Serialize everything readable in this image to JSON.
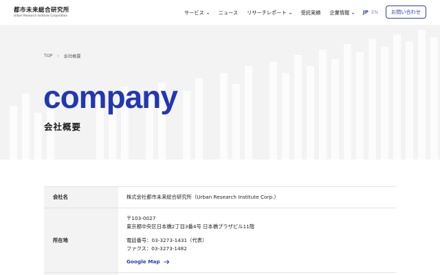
{
  "header": {
    "logo_main": "都市未来総合研究所",
    "logo_sub": "Urban Research Institute Corporation",
    "nav": [
      {
        "label": "サービス",
        "has_dropdown": true
      },
      {
        "label": "ニュース",
        "has_dropdown": false
      },
      {
        "label": "リサーチレポート",
        "has_dropdown": true
      },
      {
        "label": "受託実績",
        "has_dropdown": false
      },
      {
        "label": "企業情報",
        "has_dropdown": true
      }
    ],
    "lang_jp": "JP",
    "lang_en": "EN",
    "contact_label": "お問い合わせ"
  },
  "breadcrumb": {
    "home": "TOP",
    "separator": "›",
    "current": "会社概要"
  },
  "hero": {
    "title": "company",
    "subtitle": "会社概要"
  },
  "table": {
    "rows": [
      {
        "label": "会社名",
        "value": "株式会社都市未来総合研究所（Urban Research Institute Corp.）"
      },
      {
        "label": "所在地",
        "postal": "〒103-0027",
        "address": "東京都中央区日本橋2丁目3番4号 日本橋プラザビル11階",
        "tel": "電話番号：03-3273-1431（代表）",
        "fax": "ファクス：03-3273-1482",
        "map_link": "Google Map"
      }
    ]
  },
  "colors": {
    "accent": "#2237b3",
    "hero_bg": "#f3f3f3",
    "table_label_bg": "#f3f3f3"
  }
}
